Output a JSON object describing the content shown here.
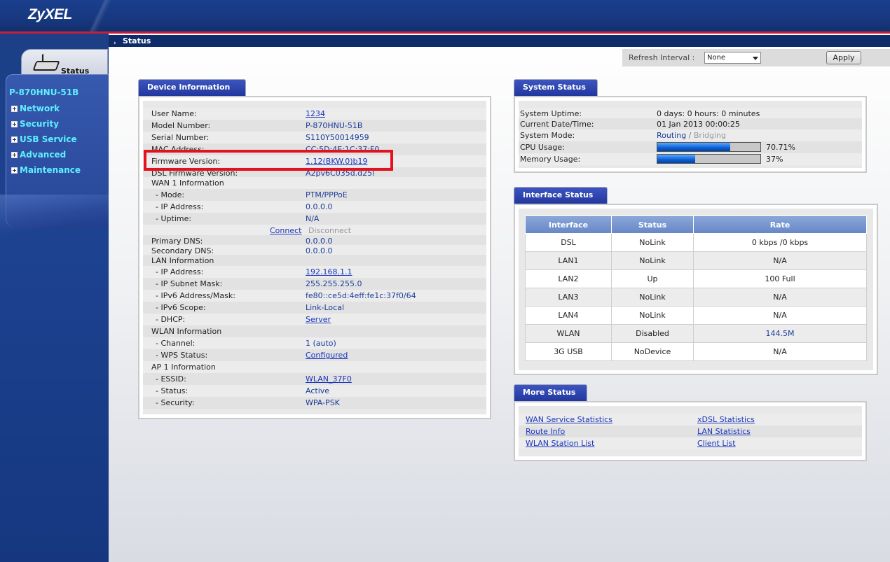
{
  "brand": "ZyXEL",
  "sidebar": {
    "status_tab_label": "Status",
    "model": "P-870HNU-51B",
    "items": [
      {
        "label": "Network"
      },
      {
        "label": "Security"
      },
      {
        "label": "USB Service"
      },
      {
        "label": "Advanced"
      },
      {
        "label": "Maintenance"
      }
    ]
  },
  "header": {
    "title": "Status"
  },
  "refresh": {
    "label": "Refresh Interval :",
    "selected": "None",
    "apply_label": "Apply"
  },
  "device_info": {
    "title": "Device Information",
    "user_name": {
      "label": "User Name:",
      "value": "1234"
    },
    "model_number": {
      "label": "Model Number:",
      "value": "P-870HNU-51B"
    },
    "serial_number": {
      "label": "Serial Number:",
      "value": "S110Y50014959"
    },
    "mac_address": {
      "label": "MAC Address:",
      "value": "CC:5D:4E:1C:37:F0"
    },
    "firmware_version": {
      "label": "Firmware Version:",
      "value": "1.12(BKW.0)b19"
    },
    "dsl_firmware": {
      "label": "DSL Firmware Version:",
      "value": "A2pv6C035d.d25l"
    },
    "wan1": {
      "label": "WAN 1 Information",
      "mode": {
        "label": "- Mode:",
        "value": "PTM/PPPoE"
      },
      "ip": {
        "label": "- IP Address:",
        "value": "0.0.0.0"
      },
      "uptime": {
        "label": "- Uptime:",
        "value": "N/A"
      },
      "connect": "Connect",
      "disconnect": "Disconnect"
    },
    "primary_dns": {
      "label": "Primary DNS:",
      "value": "0.0.0.0"
    },
    "secondary_dns": {
      "label": "Secondary DNS:",
      "value": "0.0.0.0"
    },
    "lan": {
      "label": "LAN Information",
      "ip": {
        "label": "- IP Address:",
        "value": "192.168.1.1"
      },
      "mask": {
        "label": "- IP Subnet Mask:",
        "value": "255.255.255.0"
      },
      "ipv6": {
        "label": "- IPv6 Address/Mask:",
        "value": "fe80::ce5d:4eff:fe1c:37f0/64"
      },
      "ipv6_scope": {
        "label": "- IPv6 Scope:",
        "value": "Link-Local"
      },
      "dhcp": {
        "label": "- DHCP:",
        "value": "Server"
      }
    },
    "wlan": {
      "label": "WLAN Information",
      "channel": {
        "label": "- Channel:",
        "value": "1 (auto)"
      },
      "wps": {
        "label": "- WPS Status:",
        "value": "Configured"
      }
    },
    "ap1": {
      "label": "AP 1 Information",
      "essid": {
        "label": "- ESSID:",
        "value": "WLAN_37F0"
      },
      "status": {
        "label": "- Status:",
        "value": "Active"
      },
      "security": {
        "label": "- Security:",
        "value": "WPA-PSK"
      }
    }
  },
  "system_status": {
    "title": "System Status",
    "uptime": {
      "label": "System Uptime:",
      "value": "0 days: 0 hours: 0 minutes"
    },
    "datetime": {
      "label": "Current Date/Time:",
      "value": "01 Jan 2013 00:00:25"
    },
    "mode": {
      "label": "System Mode:",
      "routing": "Routing",
      "sep": " / ",
      "bridging": "Bridging"
    },
    "cpu": {
      "label": "CPU Usage:",
      "value": "70.71%",
      "fraction": 0.7071
    },
    "memory": {
      "label": "Memory Usage:",
      "value": "37%",
      "fraction": 0.37
    }
  },
  "interface_status": {
    "title": "Interface Status",
    "columns": [
      "Interface",
      "Status",
      "Rate"
    ],
    "rows": [
      {
        "iface": "DSL",
        "status": "NoLink",
        "rate": "0 kbps /0 kbps"
      },
      {
        "iface": "LAN1",
        "status": "NoLink",
        "rate": "N/A"
      },
      {
        "iface": "LAN2",
        "status": "Up",
        "rate": "100 Full"
      },
      {
        "iface": "LAN3",
        "status": "NoLink",
        "rate": "N/A"
      },
      {
        "iface": "LAN4",
        "status": "NoLink",
        "rate": "N/A"
      },
      {
        "iface": "WLAN",
        "status": "Disabled",
        "rate": "144.5M"
      },
      {
        "iface": "3G USB",
        "status": "NoDevice",
        "rate": "N/A"
      }
    ]
  },
  "more_status": {
    "title": "More Status",
    "links": [
      "WAN Service Statistics",
      "xDSL Statistics",
      "Route Info",
      "LAN Statistics",
      "WLAN Station List",
      "Client List"
    ]
  }
}
